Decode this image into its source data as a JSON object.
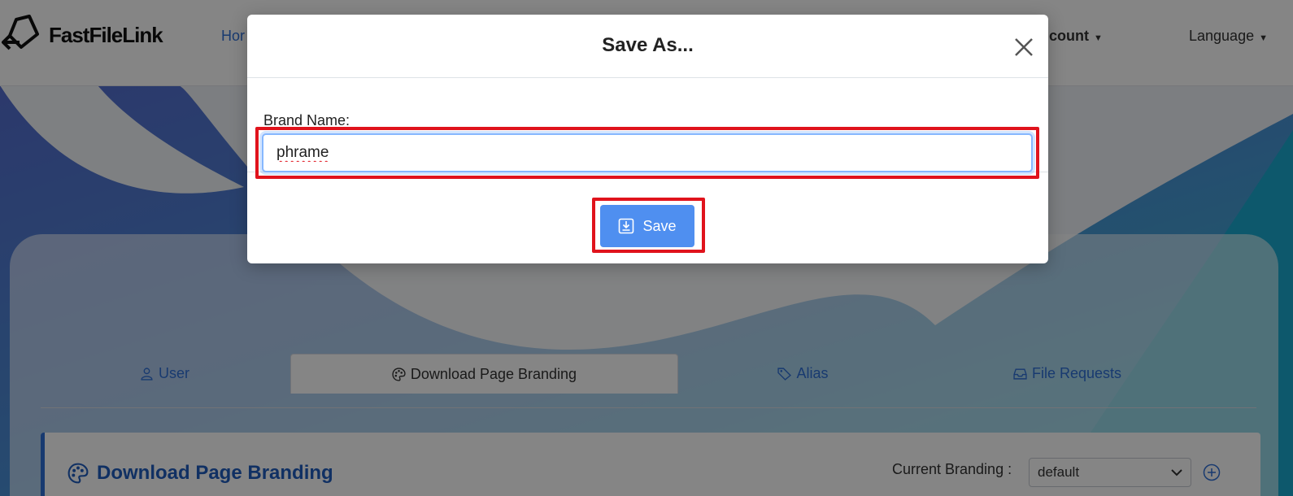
{
  "app": {
    "brand": "FastFileLink"
  },
  "nav": {
    "home": "Hor",
    "account": "count",
    "language": "Language"
  },
  "tabs": [
    {
      "label": "User",
      "icon": "user-icon"
    },
    {
      "label": "Download Page Branding",
      "icon": "palette-icon",
      "active": true
    },
    {
      "label": "Alias",
      "icon": "tag-icon"
    },
    {
      "label": "File Requests",
      "icon": "inbox-icon"
    }
  ],
  "section": {
    "title": "Download Page Branding",
    "current_branding_label": "Current Branding :",
    "current_branding_value": "default"
  },
  "modal": {
    "title": "Save As...",
    "field_label": "Brand Name:",
    "field_value": "phrame",
    "save_label": "Save"
  },
  "colors": {
    "accent": "#2f6fd6",
    "save_button": "#4f8ff0",
    "highlight": "#e0131c"
  }
}
